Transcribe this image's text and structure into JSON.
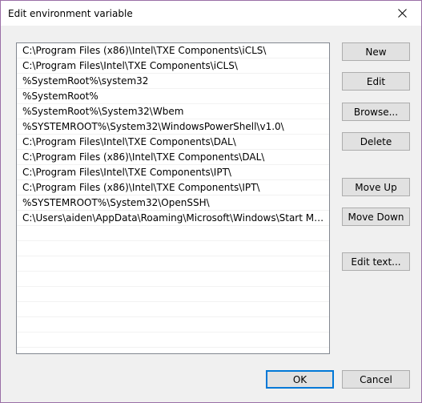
{
  "window": {
    "title": "Edit environment variable"
  },
  "list": {
    "items": [
      "C:\\Program Files (x86)\\Intel\\TXE Components\\iCLS\\",
      "C:\\Program Files\\Intel\\TXE Components\\iCLS\\",
      "%SystemRoot%\\system32",
      "%SystemRoot%",
      "%SystemRoot%\\System32\\Wbem",
      "%SYSTEMROOT%\\System32\\WindowsPowerShell\\v1.0\\",
      "C:\\Program Files\\Intel\\TXE Components\\DAL\\",
      "C:\\Program Files (x86)\\Intel\\TXE Components\\DAL\\",
      "C:\\Program Files\\Intel\\TXE Components\\IPT\\",
      "C:\\Program Files (x86)\\Intel\\TXE Components\\IPT\\",
      "%SYSTEMROOT%\\System32\\OpenSSH\\",
      "C:\\Users\\aiden\\AppData\\Roaming\\Microsoft\\Windows\\Start Menu\\Pr..."
    ]
  },
  "buttons": {
    "new": "New",
    "edit": "Edit",
    "browse": "Browse...",
    "delete": "Delete",
    "move_up": "Move Up",
    "move_down": "Move Down",
    "edit_text": "Edit text...",
    "ok": "OK",
    "cancel": "Cancel"
  },
  "icons": {
    "close": "close-icon"
  },
  "colors": {
    "window_border": "#9a6fa6",
    "default_button_border": "#0078d7",
    "button_face": "#e1e1e1",
    "dialog_background": "#f0f0f0"
  }
}
